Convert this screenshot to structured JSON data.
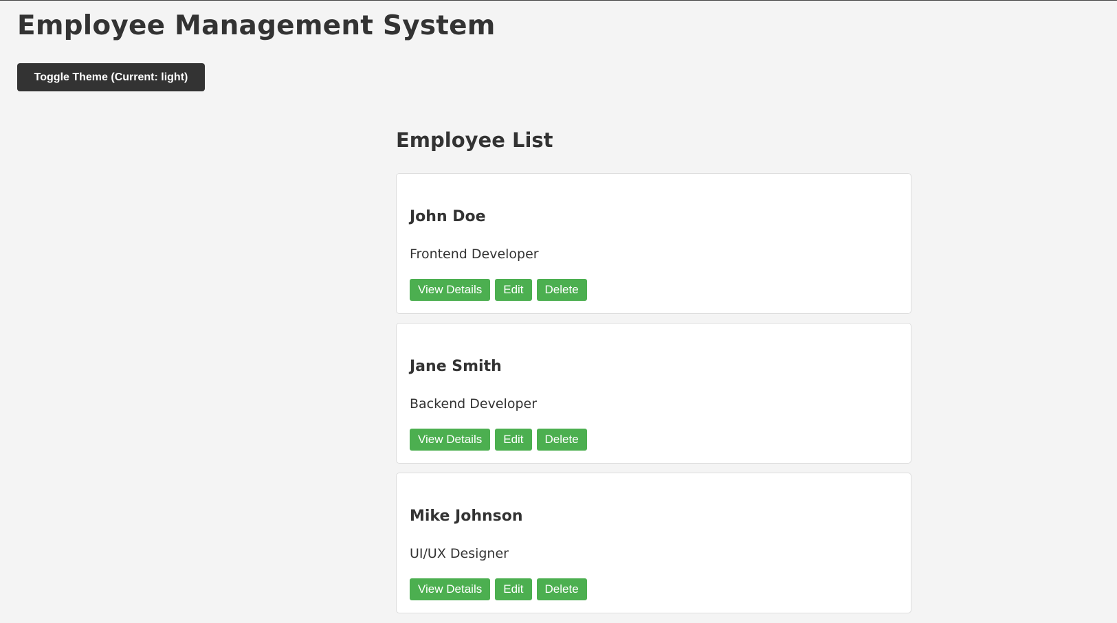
{
  "header": {
    "title": "Employee Management System",
    "theme_toggle_label": "Toggle Theme (Current: light)"
  },
  "main": {
    "list_title": "Employee List",
    "employees": [
      {
        "name": "John Doe",
        "role": "Frontend Developer",
        "actions": {
          "view": "View Details",
          "edit": "Edit",
          "delete": "Delete"
        }
      },
      {
        "name": "Jane Smith",
        "role": "Backend Developer",
        "actions": {
          "view": "View Details",
          "edit": "Edit",
          "delete": "Delete"
        }
      },
      {
        "name": "Mike Johnson",
        "role": "UI/UX Designer",
        "actions": {
          "view": "View Details",
          "edit": "Edit",
          "delete": "Delete"
        }
      }
    ]
  },
  "theme": {
    "current": "light",
    "accent": "#4caf50",
    "button_dark": "#333333",
    "background": "#f4f4f4"
  }
}
